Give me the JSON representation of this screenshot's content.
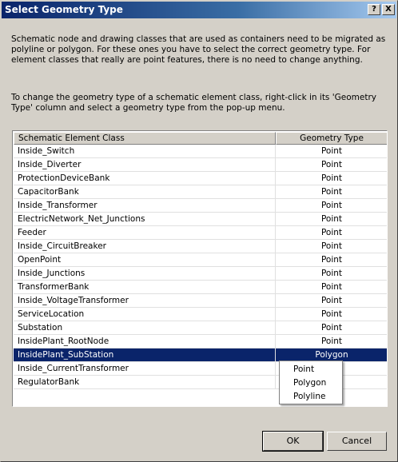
{
  "window": {
    "title": "Select Geometry Type",
    "help_label": "?",
    "close_label": "X"
  },
  "instructions": {
    "p1": "Schematic node and drawing classes that are used as containers need to be migrated as polyline or polygon. For these ones you have to select the correct geometry type. For element classes that really are point features, there is no need to change anything.",
    "p2": "To change the geometry type of a schematic element class, right-click in its 'Geometry Type' column and select a geometry type from the pop-up menu."
  },
  "grid": {
    "columns": [
      "Schematic Element Class",
      "Geometry Type"
    ],
    "rows": [
      {
        "name": "Inside_Switch",
        "type": "Point"
      },
      {
        "name": "Inside_Diverter",
        "type": "Point"
      },
      {
        "name": "ProtectionDeviceBank",
        "type": "Point"
      },
      {
        "name": "CapacitorBank",
        "type": "Point"
      },
      {
        "name": "Inside_Transformer",
        "type": "Point"
      },
      {
        "name": "ElectricNetwork_Net_Junctions",
        "type": "Point"
      },
      {
        "name": "Feeder",
        "type": "Point"
      },
      {
        "name": "Inside_CircuitBreaker",
        "type": "Point"
      },
      {
        "name": "OpenPoint",
        "type": "Point"
      },
      {
        "name": "Inside_Junctions",
        "type": "Point"
      },
      {
        "name": "TransformerBank",
        "type": "Point"
      },
      {
        "name": "Inside_VoltageTransformer",
        "type": "Point"
      },
      {
        "name": "ServiceLocation",
        "type": "Point"
      },
      {
        "name": "Substation",
        "type": "Point"
      },
      {
        "name": "InsidePlant_RootNode",
        "type": "Point"
      },
      {
        "name": "InsidePlant_SubStation",
        "type": "Polygon"
      },
      {
        "name": "Inside_CurrentTransformer",
        "type": ""
      },
      {
        "name": "RegulatorBank",
        "type": ""
      }
    ],
    "selected_index": 15
  },
  "popup_menu": {
    "items": [
      "Point",
      "Polygon",
      "Polyline"
    ]
  },
  "buttons": {
    "ok": "OK",
    "cancel": "Cancel"
  }
}
